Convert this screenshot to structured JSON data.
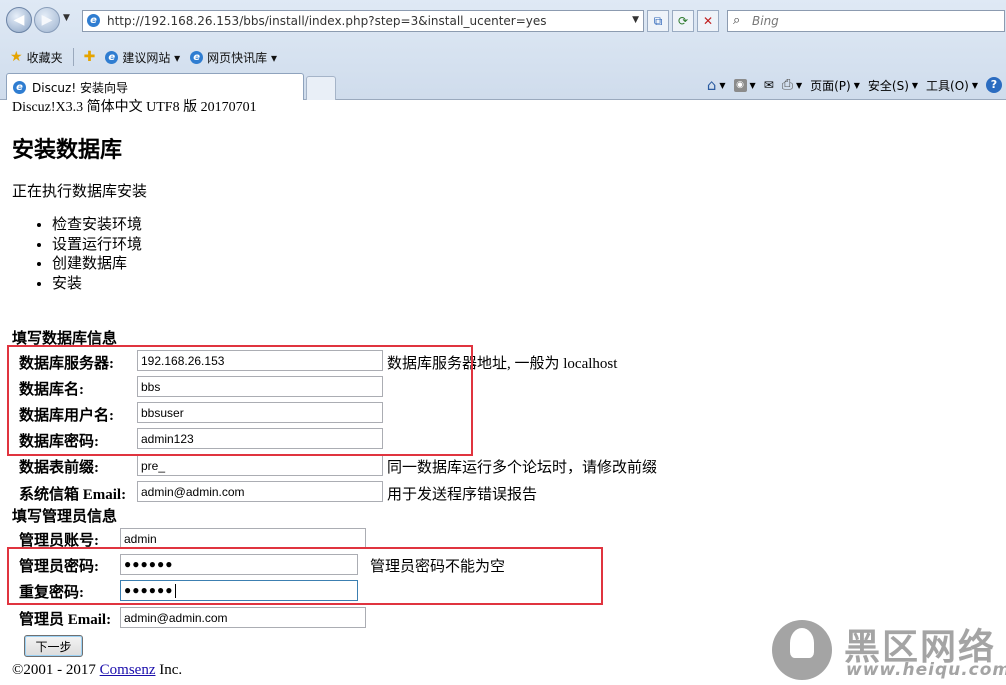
{
  "browser": {
    "url": "http://192.168.26.153/bbs/install/index.php?step=3&install_ucenter=yes",
    "search_placeholder": "Bing",
    "favorites_label": "收藏夹",
    "fav_links": [
      "建议网站 ▾",
      "网页快讯库 ▾"
    ],
    "tab_title": "Discuz! 安装向导",
    "cmd": {
      "page": "页面(P)",
      "safety": "安全(S)",
      "tools": "工具(O)"
    }
  },
  "page": {
    "header_text": "Discuz!X3.3 简体中文 UTF8 版 20170701",
    "title": "安装数据库",
    "status": "正在执行数据库安装",
    "steps": [
      "检查安装环境",
      "设置运行环境",
      "创建数据库",
      "安装"
    ],
    "db_section": "填写数据库信息",
    "db_fields": {
      "server": {
        "label": "数据库服务器:",
        "value": "192.168.26.153",
        "note": "数据库服务器地址, 一般为 localhost"
      },
      "name": {
        "label": "数据库名:",
        "value": "bbs"
      },
      "user": {
        "label": "数据库用户名:",
        "value": "bbsuser"
      },
      "password": {
        "label": "数据库密码:",
        "value": "admin123"
      },
      "prefix": {
        "label": "数据表前缀:",
        "value": "pre_",
        "note": "同一数据库运行多个论坛时，请修改前缀"
      },
      "email": {
        "label": "系统信箱 Email:",
        "value": "admin@admin.com",
        "note": "用于发送程序错误报告"
      }
    },
    "admin_section": "填写管理员信息",
    "admin_fields": {
      "account": {
        "label": "管理员账号:",
        "value": "admin"
      },
      "password": {
        "label": "管理员密码:",
        "value": "●●●●●●",
        "note": "管理员密码不能为空"
      },
      "confirm": {
        "label": "重复密码:",
        "value": "●●●●●●"
      },
      "email": {
        "label": "管理员 Email:",
        "value": "admin@admin.com"
      }
    },
    "next_button": "下一步",
    "footer_prefix": "©2001 - 2017 ",
    "footer_link": "Comsenz",
    "footer_suffix": " Inc."
  },
  "watermark": {
    "cn": "黑区网络",
    "url": "www.heiqu.com"
  },
  "colors": {
    "highlight": "#e0343f",
    "chrome": "#dfe9f5",
    "link": "#1a0dab"
  }
}
